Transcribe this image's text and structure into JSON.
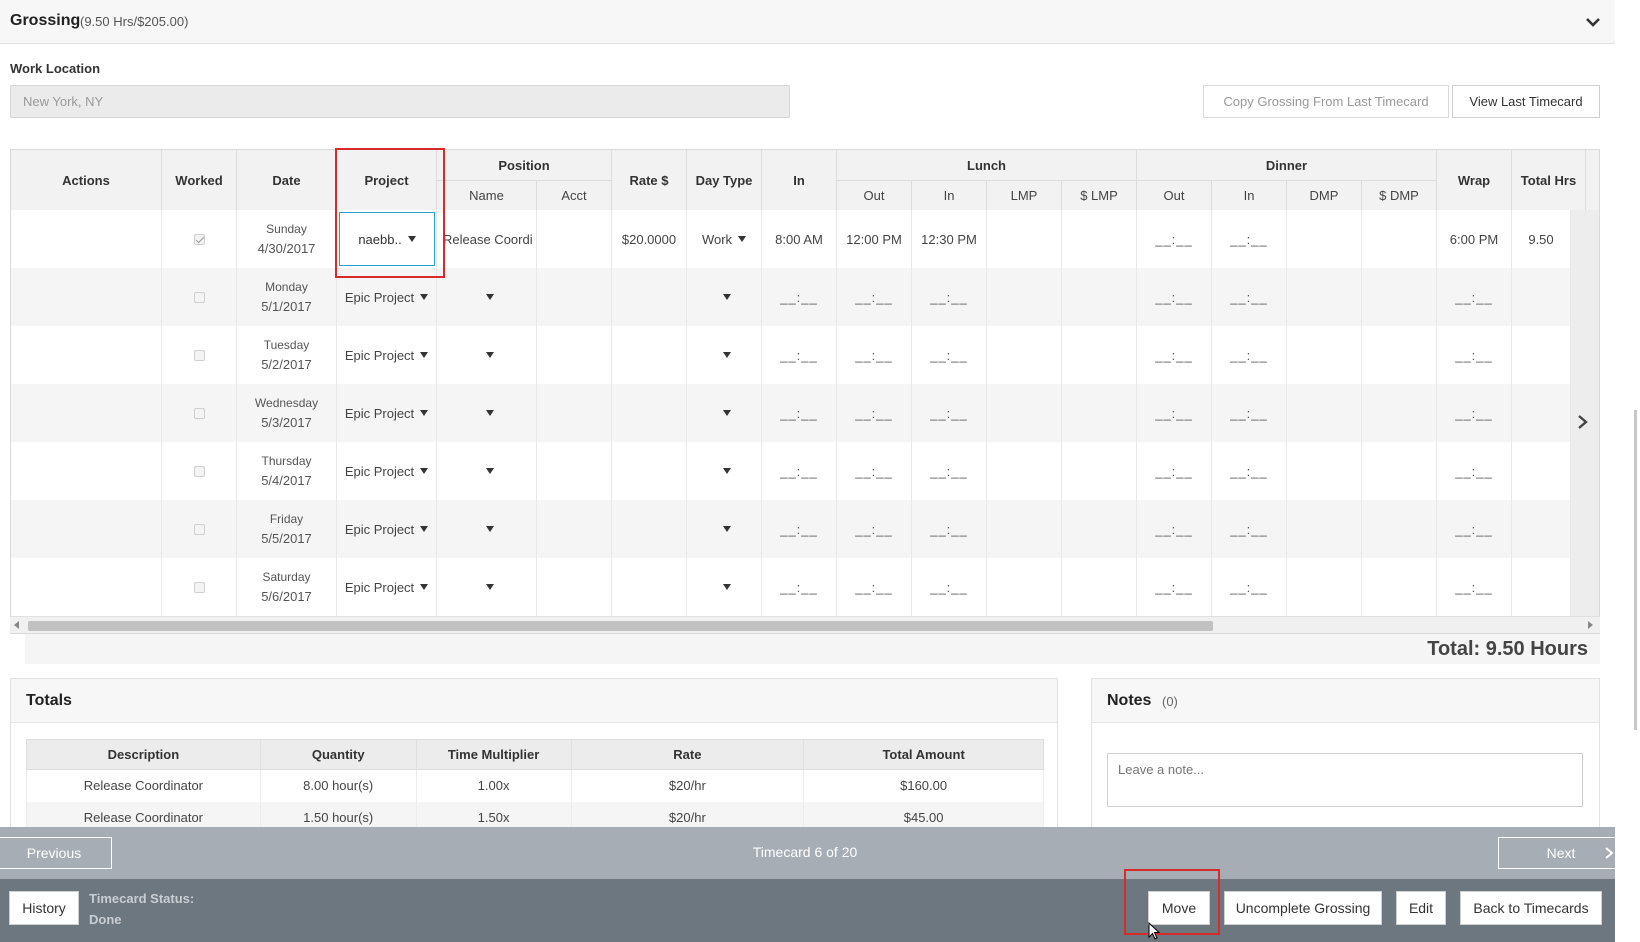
{
  "grossing": {
    "title": "Grossing",
    "summary": "(9.50 Hrs/$205.00)"
  },
  "work_location": {
    "label": "Work Location",
    "value": "New York, NY"
  },
  "buttons": {
    "copy_grossing": "Copy Grossing From Last Timecard",
    "view_last": "View Last Timecard"
  },
  "grid": {
    "headers": {
      "actions": "Actions",
      "worked": "Worked",
      "date": "Date",
      "project": "Project",
      "position": "Position",
      "position_name": "Name",
      "position_acct": "Acct",
      "rate": "Rate $",
      "day_type": "Day Type",
      "in": "In",
      "lunch": "Lunch",
      "lunch_out": "Out",
      "lunch_in": "In",
      "lmp": "LMP",
      "dollar_lmp": "$ LMP",
      "dinner": "Dinner",
      "dinner_out": "Out",
      "dinner_in": "In",
      "dmp": "DMP",
      "dollar_dmp": "$ DMP",
      "wrap": "Wrap",
      "total_hrs": "Total Hrs"
    },
    "rows": [
      {
        "day": "Sunday",
        "date": "4/30/2017",
        "worked": true,
        "project": "naebb..",
        "position": "Release Coordi",
        "rate": "$20.0000",
        "day_type": "Work",
        "in": "8:00 AM",
        "lunch_out": "12:00 PM",
        "lunch_in": "12:30 PM",
        "dinner_out": "__:__",
        "dinner_in": "__:__",
        "wrap": "6:00 PM",
        "total": "9.50"
      },
      {
        "day": "Monday",
        "date": "5/1/2017",
        "worked": false,
        "project": "Epic Project",
        "position": "",
        "rate": "",
        "day_type": "",
        "in": "__:__",
        "lunch_out": "__:__",
        "lunch_in": "__:__",
        "dinner_out": "__:__",
        "dinner_in": "__:__",
        "wrap": "__:__",
        "total": ""
      },
      {
        "day": "Tuesday",
        "date": "5/2/2017",
        "worked": false,
        "project": "Epic Project",
        "position": "",
        "rate": "",
        "day_type": "",
        "in": "__:__",
        "lunch_out": "__:__",
        "lunch_in": "__:__",
        "dinner_out": "__:__",
        "dinner_in": "__:__",
        "wrap": "__:__",
        "total": ""
      },
      {
        "day": "Wednesday",
        "date": "5/3/2017",
        "worked": false,
        "project": "Epic Project",
        "position": "",
        "rate": "",
        "day_type": "",
        "in": "__:__",
        "lunch_out": "__:__",
        "lunch_in": "__:__",
        "dinner_out": "__:__",
        "dinner_in": "__:__",
        "wrap": "__:__",
        "total": ""
      },
      {
        "day": "Thursday",
        "date": "5/4/2017",
        "worked": false,
        "project": "Epic Project",
        "position": "",
        "rate": "",
        "day_type": "",
        "in": "__:__",
        "lunch_out": "__:__",
        "lunch_in": "__:__",
        "dinner_out": "__:__",
        "dinner_in": "__:__",
        "wrap": "__:__",
        "total": ""
      },
      {
        "day": "Friday",
        "date": "5/5/2017",
        "worked": false,
        "project": "Epic Project",
        "position": "",
        "rate": "",
        "day_type": "",
        "in": "__:__",
        "lunch_out": "__:__",
        "lunch_in": "__:__",
        "dinner_out": "__:__",
        "dinner_in": "__:__",
        "wrap": "__:__",
        "total": ""
      },
      {
        "day": "Saturday",
        "date": "5/6/2017",
        "worked": false,
        "project": "Epic Project",
        "position": "",
        "rate": "",
        "day_type": "",
        "in": "__:__",
        "lunch_out": "__:__",
        "lunch_in": "__:__",
        "dinner_out": "__:__",
        "dinner_in": "__:__",
        "wrap": "__:__",
        "total": ""
      }
    ],
    "total_label": "Total: 9.50 Hours"
  },
  "totals": {
    "title": "Totals",
    "headers": [
      "Description",
      "Quantity",
      "Time Multiplier",
      "Rate",
      "Total Amount"
    ],
    "rows": [
      [
        "Release Coordinator",
        "8.00 hour(s)",
        "1.00x",
        "$20/hr",
        "$160.00"
      ],
      [
        "Release Coordinator",
        "1.50 hour(s)",
        "1.50x",
        "$20/hr",
        "$45.00"
      ]
    ]
  },
  "notes": {
    "title": "Notes",
    "count": "(0)",
    "placeholder": "Leave a note..."
  },
  "nav": {
    "previous": "Previous",
    "position": "Timecard 6 of 20",
    "next": "Next"
  },
  "actions": {
    "history": "History",
    "status_label": "Timecard Status:",
    "status_value": "Done",
    "move": "Move",
    "uncomplete": "Uncomplete Grossing",
    "edit": "Edit",
    "back": "Back to Timecards"
  },
  "colors": {
    "highlight": "#d62b2b",
    "focus": "#2aa0d6",
    "nav_bar": "#a6adb4",
    "action_bar": "#6c7780"
  }
}
